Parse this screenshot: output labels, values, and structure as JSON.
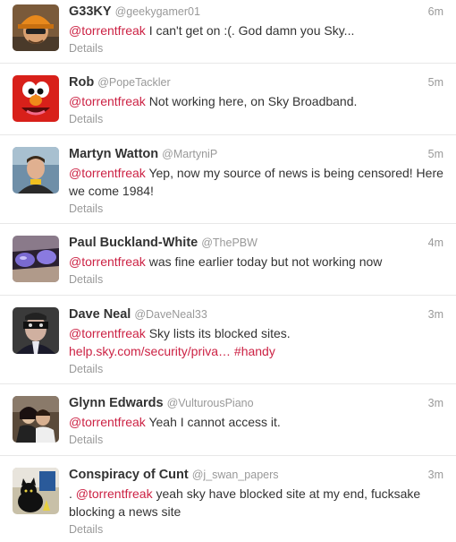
{
  "tweets": [
    {
      "fullname": "G33KY",
      "username": "@geekygamer01",
      "time": "6m",
      "mention": "@torrentfreak",
      "text": " I can't get on :(. God damn you Sky...",
      "details": "Details",
      "avatar_icon": "engineer-avatar-icon"
    },
    {
      "fullname": "Rob",
      "username": "@PopeTackler",
      "time": "5m",
      "mention": "@torrentfreak",
      "text": " Not working here, on Sky Broadband.",
      "details": "Details",
      "avatar_icon": "red-monster-avatar-icon"
    },
    {
      "fullname": "Martyn Watton",
      "username": "@MartyniP",
      "time": "5m",
      "mention": "@torrentfreak",
      "text": " Yep, now my source of news is being censored! Here we come 1984!",
      "details": "Details",
      "avatar_icon": "man-portrait-avatar-icon"
    },
    {
      "fullname": "Paul Buckland-White",
      "username": "@ThePBW",
      "time": "4m",
      "mention": "@torrentfreak",
      "text": " was fine earlier today but not working now",
      "details": "Details",
      "avatar_icon": "sunglasses-avatar-icon"
    },
    {
      "fullname": "Dave Neal",
      "username": "@DaveNeal33",
      "time": "3m",
      "mention": "@torrentfreak",
      "text": " Sky lists its blocked sites.",
      "link": "help.sky.com/security/priva…",
      "hashtag": "#handy",
      "details": "Details",
      "avatar_icon": "masked-man-avatar-icon"
    },
    {
      "fullname": "Glynn Edwards",
      "username": "@VulturousPiano",
      "time": "3m",
      "mention": "@torrentfreak",
      "text": " Yeah I cannot access it.",
      "details": "Details",
      "avatar_icon": "couple-photo-avatar-icon"
    },
    {
      "fullname": "Conspiracy of Cunt",
      "username": "@j_swan_papers",
      "time": "3m",
      "prefix": ". ",
      "mention": "@torrentfreak",
      "text": " yeah sky have blocked site at my end, fucksake blocking a news site",
      "details": "Details",
      "avatar_icon": "cat-photo-avatar-icon"
    }
  ]
}
